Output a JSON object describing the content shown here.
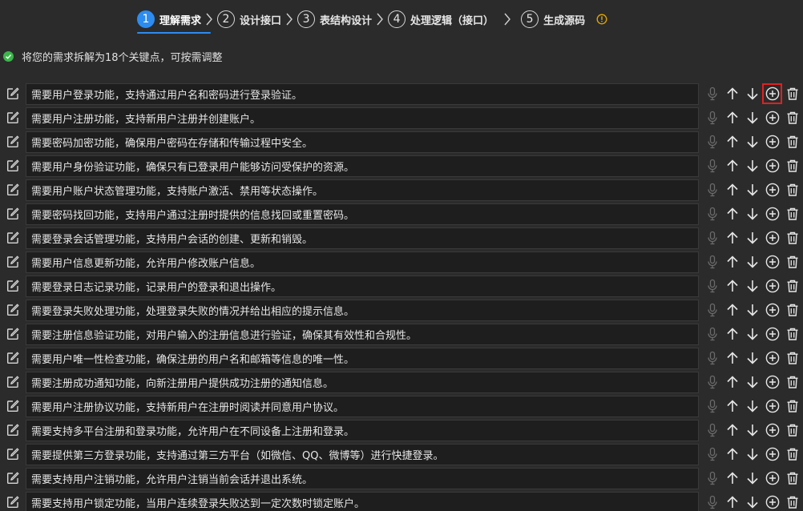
{
  "steps": [
    {
      "num": "1",
      "label": "理解需求",
      "active": true
    },
    {
      "num": "2",
      "label": "设计接口",
      "active": false
    },
    {
      "num": "3",
      "label": "表结构设计",
      "active": false
    },
    {
      "num": "4",
      "label": "处理逻辑（接口）",
      "active": false
    },
    {
      "num": "5",
      "label": "生成源码",
      "active": false
    }
  ],
  "status": {
    "text": "将您的需求拆解为18个关键点，可按需调整"
  },
  "colors": {
    "accent": "#2d8cf0",
    "success": "#3bb54a",
    "warning": "#e6a700",
    "highlight": "#e02020",
    "background": "#2b2b2b",
    "field": "#1e1e1e"
  },
  "icons": {
    "edit": "edit-icon",
    "mic": "microphone-icon",
    "up": "arrow-up-icon",
    "down": "arrow-down-icon",
    "add": "plus-circle-icon",
    "delete": "trash-icon"
  },
  "requirements": [
    "需要用户登录功能，支持通过用户名和密码进行登录验证。",
    "需要用户注册功能，支持新用户注册并创建账户。",
    "需要密码加密功能，确保用户密码在存储和传输过程中安全。",
    "需要用户身份验证功能，确保只有已登录用户能够访问受保护的资源。",
    "需要用户账户状态管理功能，支持账户激活、禁用等状态操作。",
    "需要密码找回功能，支持用户通过注册时提供的信息找回或重置密码。",
    "需要登录会话管理功能，支持用户会话的创建、更新和销毁。",
    "需要用户信息更新功能，允许用户修改账户信息。",
    "需要登录日志记录功能，记录用户的登录和退出操作。",
    "需要登录失败处理功能，处理登录失败的情况并给出相应的提示信息。",
    "需要注册信息验证功能，对用户输入的注册信息进行验证，确保其有效性和合规性。",
    "需要用户唯一性检查功能，确保注册的用户名和邮箱等信息的唯一性。",
    "需要注册成功通知功能，向新注册用户提供成功注册的通知信息。",
    "需要用户注册协议功能，支持新用户在注册时阅读并同意用户协议。",
    "需要支持多平台注册和登录功能，允许用户在不同设备上注册和登录。",
    "需要提供第三方登录功能，支持通过第三方平台（如微信、QQ、微博等）进行快捷登录。",
    "需要支持用户注销功能，允许用户注销当前会话并退出系统。",
    "需要支持用户锁定功能，当用户连续登录失败达到一定次数时锁定账户。"
  ]
}
